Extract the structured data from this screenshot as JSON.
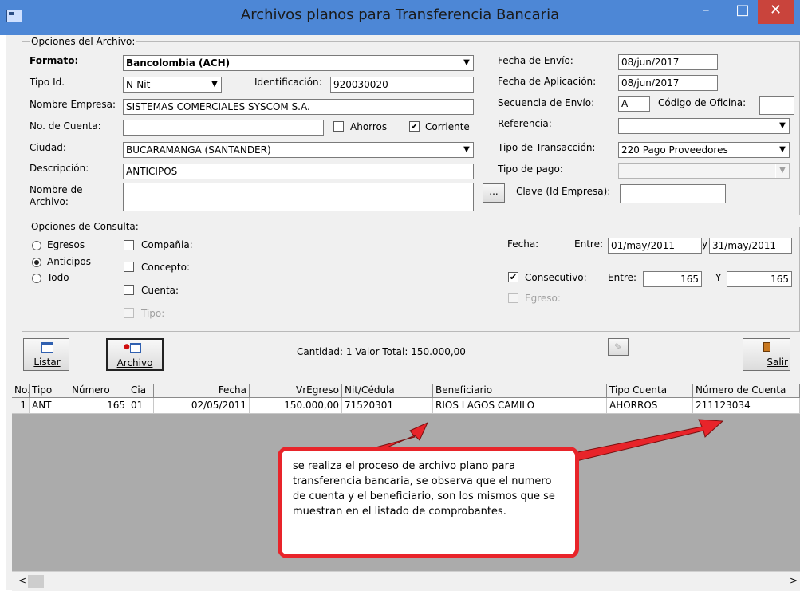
{
  "window": {
    "title": "Archivos planos para Transferencia Bancaria",
    "minimize": "–",
    "maximize": "□",
    "close": "✕"
  },
  "file_options": {
    "group_label": "Opciones del Archivo:",
    "formato_label": "Formato:",
    "formato_value": "Bancolombia (ACH)",
    "tipo_id_label": "Tipo Id.",
    "tipo_id_value": "N-Nit",
    "identificacion_label": "Identificación:",
    "identificacion_value": "920030020",
    "nombre_empresa_label": "Nombre Empresa:",
    "nombre_empresa_value": "SISTEMAS COMERCIALES SYSCOM S.A.",
    "cuenta_label": "No. de Cuenta:",
    "cuenta_value": "",
    "ahorros_label": "Ahorros",
    "ahorros_checked": false,
    "corriente_label": "Corriente",
    "corriente_checked": true,
    "ciudad_label": "Ciudad:",
    "ciudad_value": "BUCARAMANGA  (SANTANDER)",
    "descripcion_label": "Descripción:",
    "descripcion_value": "ANTICIPOS",
    "nombre_archivo_label_1": "Nombre de",
    "nombre_archivo_label_2": "Archivo:",
    "nombre_archivo_value": "",
    "browse_button": "...",
    "fecha_envio_label": "Fecha de Envío:",
    "fecha_envio_value": "08/jun/2017",
    "fecha_aplicacion_label": "Fecha de Aplicación:",
    "fecha_aplicacion_value": "08/jun/2017",
    "secuencia_label": "Secuencia de Envío:",
    "secuencia_value": "A",
    "codigo_oficina_label": "Código de Oficina:",
    "codigo_oficina_value": "",
    "referencia_label": "Referencia:",
    "referencia_value": "",
    "tipo_transaccion_label": "Tipo de Transacción:",
    "tipo_transaccion_value": "220 Pago Proveedores",
    "tipo_pago_label": "Tipo de pago:",
    "tipo_pago_value": "",
    "clave_label": "Clave (Id Empresa):",
    "clave_value": ""
  },
  "query_options": {
    "group_label": "Opciones de Consulta:",
    "egresos": "Egresos",
    "anticipos": "Anticipos",
    "todo": "Todo",
    "selected": "Anticipos",
    "compania": "Compañia:",
    "concepto": "Concepto:",
    "cuenta": "Cuenta:",
    "tipo": "Tipo:",
    "fecha_label": "Fecha:",
    "entre_label": "Entre:",
    "fecha_desde": "01/may/2011",
    "y_label": "y",
    "fecha_hasta": "31/may/2011",
    "consecutivo_label": "Consecutivo:",
    "consecutivo_checked": true,
    "consec_entre_label": "Entre:",
    "consec_desde": "165",
    "consec_y_label": "Y",
    "consec_hasta": "165",
    "egreso_label": "Egreso:"
  },
  "toolbar": {
    "listar": "Listar",
    "archivo": "Archivo",
    "salir": "Salir",
    "summary": "Cantidad: 1 Valor Total: 150.000,00"
  },
  "table": {
    "headers": [
      "No.",
      "Tipo",
      "Número",
      "Cia",
      "Fecha",
      "VrEgreso",
      "Nit/Cédula",
      "Beneficiario",
      "Tipo Cuenta",
      "Número de Cuenta"
    ],
    "rows": [
      [
        "1",
        "ANT",
        "165",
        "01",
        "02/05/2011",
        "150.000,00",
        "71520301",
        "RIOS LAGOS CAMILO",
        "AHORROS",
        "211123034"
      ]
    ]
  },
  "callout": {
    "text": "se realiza el proceso de archivo plano para transferencia bancaria, se observa que el numero de cuenta y el beneficiario, son los mismos que se muestran en el listado de comprobantes."
  },
  "scrollbar": {
    "left": "<",
    "right": ">"
  },
  "colors": {
    "titlebar": "#4d87d6",
    "close": "#c9443c",
    "callout_border": "#e8242a",
    "window_bg": "#f0f0f0"
  }
}
